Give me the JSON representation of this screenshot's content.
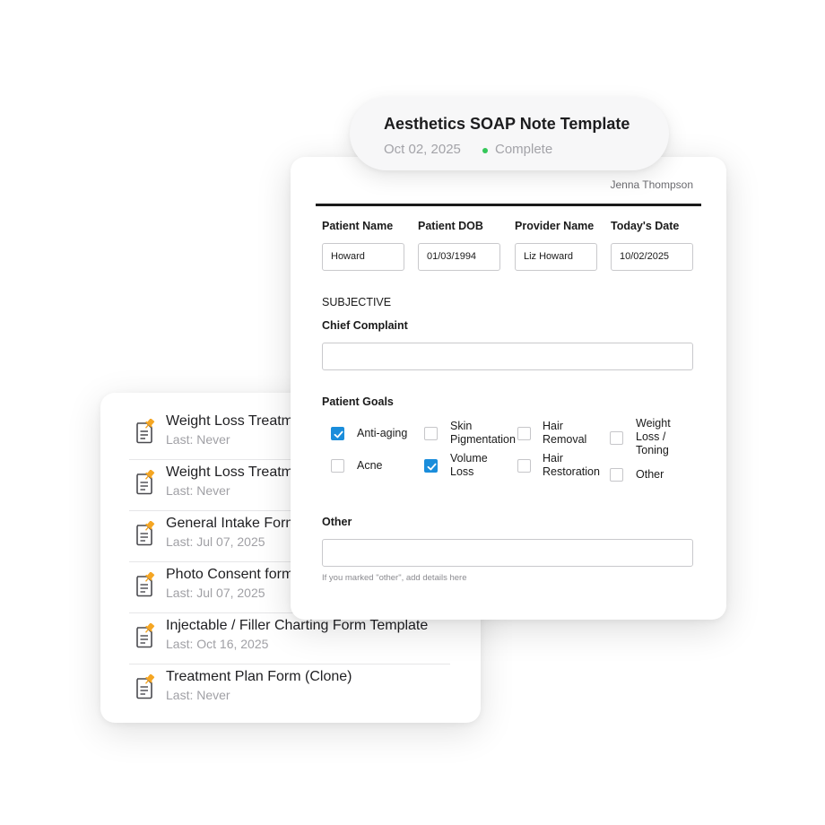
{
  "template_list": {
    "items": [
      {
        "title": "Weight Loss Treatm",
        "subtitle": "Last: Never"
      },
      {
        "title": "Weight Loss Treatm",
        "subtitle": "Last: Never"
      },
      {
        "title": "General Intake Form",
        "subtitle": "Last: Jul 07, 2025"
      },
      {
        "title": "Photo Consent form",
        "subtitle": "Last: Jul 07, 2025"
      },
      {
        "title": "Injectable / Filler Charting Form Template",
        "subtitle": "Last: Oct 16, 2025"
      },
      {
        "title": "Treatment Plan Form (Clone)",
        "subtitle": "Last: Never"
      }
    ],
    "icon": "pinned-document-icon",
    "pin_color": "#f5a623"
  },
  "title_card": {
    "title": "Aesthetics SOAP Note Template",
    "date": "Oct 02, 2025",
    "status": "Complete",
    "status_color": "#34c759"
  },
  "form": {
    "author": "Jenna Thompson",
    "fields": [
      {
        "label": "Patient Name",
        "value": "Howard"
      },
      {
        "label": "Patient DOB",
        "value": "01/03/1994"
      },
      {
        "label": "Provider Name",
        "value": "Liz Howard"
      },
      {
        "label": "Today's Date",
        "value": "10/02/2025"
      }
    ],
    "section_title": "SUBJECTIVE",
    "chief_complaint_label": "Chief Complaint",
    "chief_complaint_value": "",
    "patient_goals_label": "Patient Goals",
    "goals": [
      {
        "label": "Anti-aging",
        "checked": true
      },
      {
        "label": "Skin Pigmentation",
        "checked": false
      },
      {
        "label": "Hair Removal",
        "checked": false
      },
      {
        "label": "Weight Loss / Toning",
        "checked": false
      },
      {
        "label": "Acne",
        "checked": false
      },
      {
        "label": "Volume Loss",
        "checked": true
      },
      {
        "label": "Hair Restoration",
        "checked": false
      },
      {
        "label": "Other",
        "checked": false
      }
    ],
    "other_label": "Other",
    "other_value": "",
    "other_hint": "If you marked \"other\", add details here",
    "check_color": "#1a8ddb"
  }
}
